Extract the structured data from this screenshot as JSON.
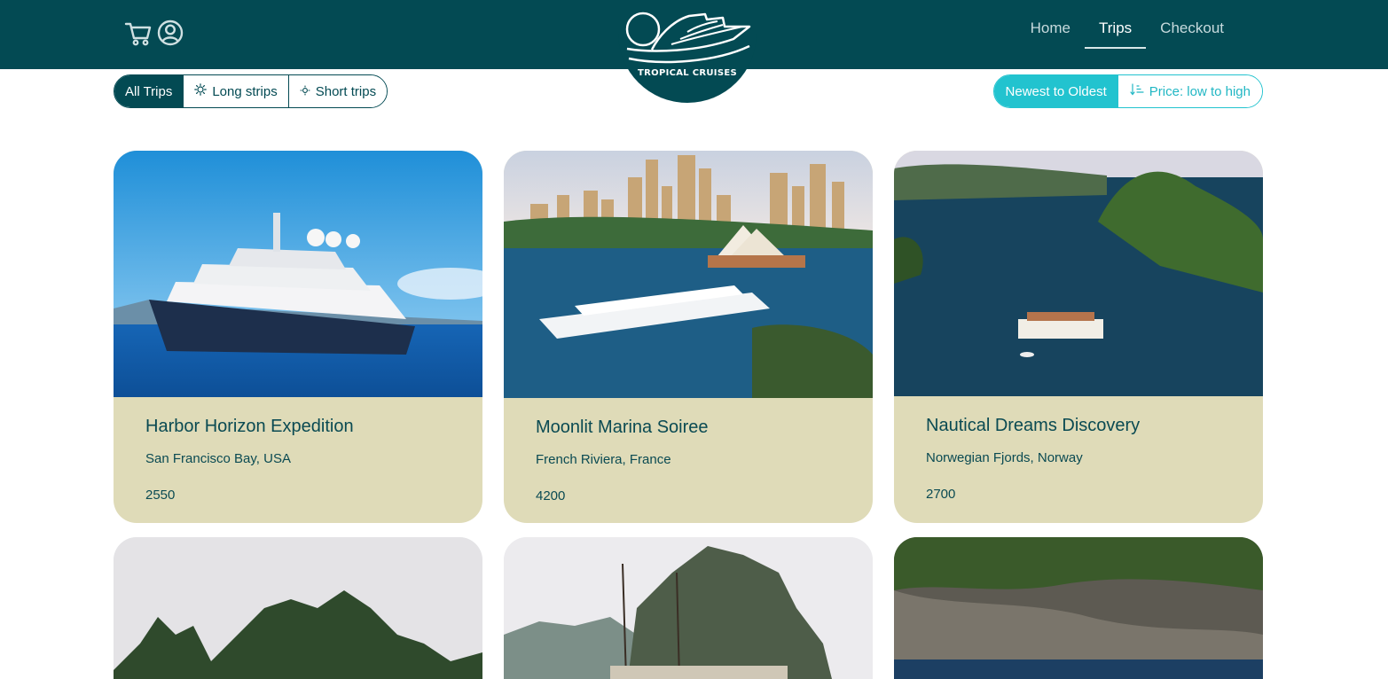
{
  "header": {
    "logo_text": "TROPICAL CRUISES",
    "icons": [
      "cart-icon",
      "user-circle-icon"
    ],
    "nav": [
      {
        "label": "Home",
        "active": false
      },
      {
        "label": "Trips",
        "active": true
      },
      {
        "label": "Checkout",
        "active": false
      }
    ]
  },
  "filters": [
    {
      "label": "All Trips",
      "active": true,
      "icon": ""
    },
    {
      "label": "Long strips",
      "active": false,
      "icon": "sun-icon"
    },
    {
      "label": "Short trips",
      "active": false,
      "icon": "small-sun-icon"
    }
  ],
  "sort": [
    {
      "label": "Newest to Oldest",
      "active": true,
      "icon": ""
    },
    {
      "label": "Price: low to high",
      "active": false,
      "icon": "sort-ascending-icon"
    }
  ],
  "trips": [
    {
      "title": "Harbor Horizon Expedition",
      "location": "San Francisco Bay, USA",
      "price": "2550"
    },
    {
      "title": "Moonlit Marina Soiree",
      "location": "French Riviera, France",
      "price": "4200"
    },
    {
      "title": "Nautical Dreams Discovery",
      "location": "Norwegian Fjords, Norway",
      "price": "2700"
    }
  ],
  "colors": {
    "header_bg": "#034a53",
    "card_bg": "#dfdbb8",
    "accent": "#22c3cf",
    "text": "#0a4a52"
  }
}
